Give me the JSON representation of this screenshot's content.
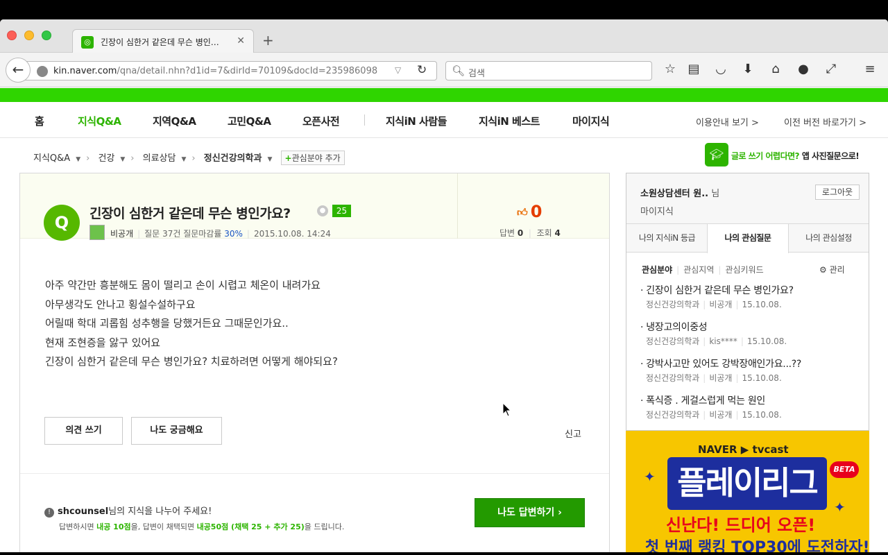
{
  "tab": {
    "title": "긴장이 심한거 같은데 무슨 병인…",
    "close": "✕",
    "new": "+"
  },
  "nav": {
    "url_host": "kin.naver.com",
    "url_path": "/qna/detail.nhn?d1id=7&dirId=70109&docId=235986098",
    "search_placeholder": "검색"
  },
  "gnb": {
    "items": [
      "홈",
      "지식Q&A",
      "지역Q&A",
      "고민Q&A",
      "오픈사전",
      "지식iN 사람들",
      "지식iN 베스트",
      "마이지식"
    ],
    "active_index": 1,
    "right": [
      "이용안내 보기 >",
      "이전 버전 바로가기 >"
    ]
  },
  "breadcrumb": {
    "items": [
      "지식Q&A",
      "건강",
      "의료상담",
      "정신건강의학과"
    ],
    "add_label": "관심분야 추가"
  },
  "promo": {
    "green": "글로 쓰기 어렵다면?",
    "dark": "앱 사진질문으로!"
  },
  "question": {
    "icon": "Q",
    "title": "긴장이 심한거 같은데 무슨 병인가요?",
    "badge": "25",
    "author": "비공개",
    "stats": "질문 37건 질문마감률",
    "rate": "30%",
    "date": "2015.10.08. 14:24",
    "likes": "0",
    "answers_label": "답변",
    "answers": "0",
    "views_label": "조회",
    "views": "4",
    "body": [
      "아주 약간만 흥분해도 몸이 떨리고 손이 시렵고 체온이 내려가요",
      "아무생각도 안나고 횡설수설하구요",
      "어릴때 학대 괴롭힘 성추행을 당했거든요  그때문인가요..",
      "현재 조현증을 앓구 있어요",
      "긴장이 심한거 같은데 무슨 병인가요? 치료하려면 어떻게 해야되요?"
    ],
    "btn_opinion": "의견 쓰기",
    "btn_curious": "나도 궁금해요",
    "report": "신고"
  },
  "answer_prompt": {
    "user": "shcounsel",
    "text": "님의 지식을 나누어 주세요!",
    "sub_1": "답변하시면 ",
    "pts1": "내공 10점",
    "sub_2": "을, 답변이 채택되면 ",
    "pts2": "내공50점 (채택 25 + 추가 25)",
    "sub_3": "을 드립니다.",
    "button": "나도 답변하기 ›"
  },
  "sidebar": {
    "user": "소원상담센터 원..",
    "suffix": " 님",
    "logout": "로그아웃",
    "my": "마이지식",
    "tabs": [
      "나의 지식iN 등급",
      "나의 관심질문",
      "나의 관심설정"
    ],
    "active_tab": 1,
    "subtabs": [
      "관심분야",
      "관심지역",
      "관심키워드"
    ],
    "manage": "⚙ 관리",
    "items": [
      {
        "title": "· 긴장이 심한거 같은데 무슨 병인가요?",
        "cat": "정신건강의학과",
        "user": "비공개",
        "date": "15.10.08."
      },
      {
        "title": "· 냉장고의이중성",
        "cat": "정신건강의학과",
        "user": "kis****",
        "date": "15.10.08."
      },
      {
        "title": "· 강박사고만 있어도 강박장애인가요...??",
        "cat": "정신건강의학과",
        "user": "비공개",
        "date": "15.10.08."
      },
      {
        "title": "· 폭식증 . 게걸스럽게 먹는 원인",
        "cat": "정신건강의학과",
        "user": "비공개",
        "date": "15.10.08."
      }
    ]
  },
  "ad": {
    "brand": "NAVER ▶ tvcast",
    "big": "플레이리그",
    "beta": "BETA",
    "line1": "신난다! 드디어 오픈!",
    "line2": "첫 번째 랭킹 TOP30에 도전하자!"
  }
}
